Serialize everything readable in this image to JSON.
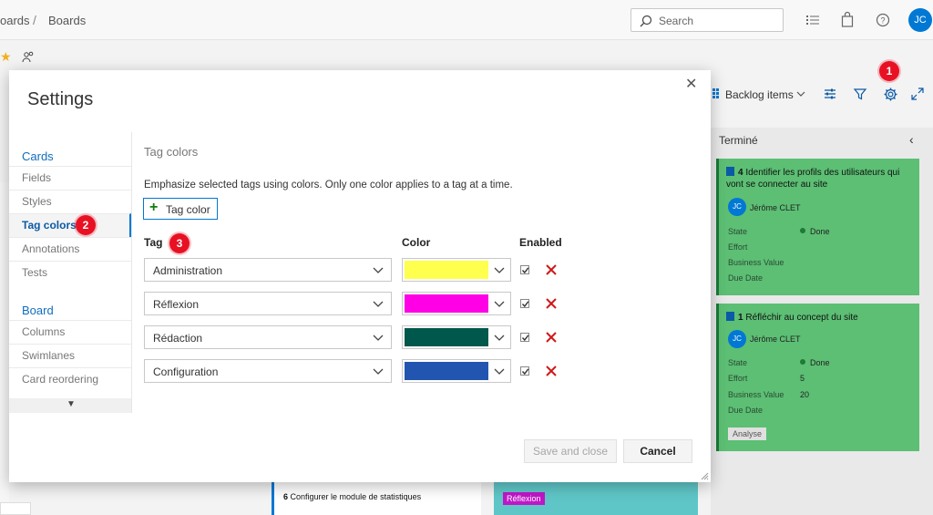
{
  "header": {
    "breadcrumb": [
      "oards",
      "Boards"
    ],
    "search_placeholder": "Search",
    "avatar_initials": "JC"
  },
  "toolbar": {
    "backlog_label": "Backlog items"
  },
  "callouts": [
    "1",
    "2",
    "3"
  ],
  "board": {
    "done_column": "Terminé",
    "cards": [
      {
        "id": "4",
        "title": "Identifier les profils des utilisateurs qui vont se connecter au site",
        "owner": "Jérôme CLET",
        "owner_initials": "JC",
        "fields": [
          {
            "label": "State",
            "value": "Done"
          },
          {
            "label": "Effort",
            "value": ""
          },
          {
            "label": "Business Value",
            "value": ""
          },
          {
            "label": "Due Date",
            "value": ""
          }
        ]
      },
      {
        "id": "1",
        "title": "Réfléchir au concept du site",
        "owner": "Jérôme CLET",
        "owner_initials": "JC",
        "fields": [
          {
            "label": "State",
            "value": "Done"
          },
          {
            "label": "Effort",
            "value": "5"
          },
          {
            "label": "Business Value",
            "value": "20"
          },
          {
            "label": "Due Date",
            "value": ""
          }
        ],
        "tag": "Analyse"
      }
    ],
    "bottom_card": {
      "id": "6",
      "title": "Configurer le module de statistiques"
    },
    "bottom_tag": "Réflexion"
  },
  "modal": {
    "title": "Settings",
    "nav": {
      "cards_section": "Cards",
      "cards_items": [
        "Fields",
        "Styles",
        "Tag colors",
        "Annotations",
        "Tests"
      ],
      "board_section": "Board",
      "board_items": [
        "Columns",
        "Swimlanes",
        "Card reordering"
      ]
    },
    "section_title": "Tag colors",
    "description": "Emphasize selected tags using colors. Only one color applies to a tag at a time.",
    "add_button": "Tag color",
    "columns": {
      "tag": "Tag",
      "color": "Color",
      "enabled": "Enabled"
    },
    "rows": [
      {
        "tag": "Administration",
        "color": "#ffff4d",
        "enabled": true
      },
      {
        "tag": "Réflexion",
        "color": "#ff00e6",
        "enabled": true
      },
      {
        "tag": "Rédaction",
        "color": "#00574b",
        "enabled": true
      },
      {
        "tag": "Configuration",
        "color": "#2255b0",
        "enabled": true
      }
    ],
    "save_button": "Save and close",
    "cancel_button": "Cancel"
  }
}
